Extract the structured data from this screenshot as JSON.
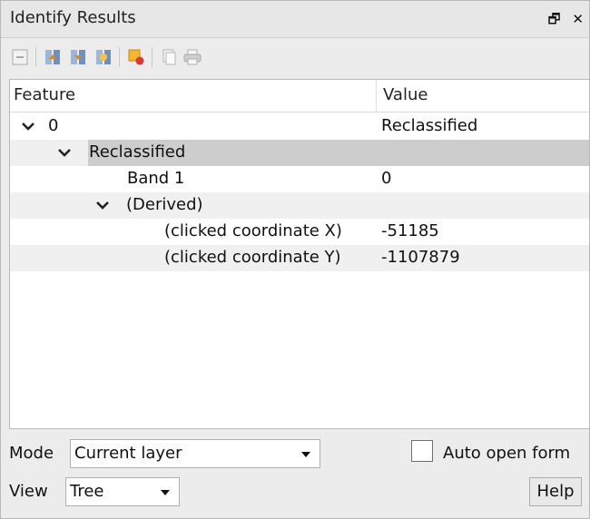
{
  "title": "Identify Results",
  "title_buttons": {
    "float": "🗗",
    "close": "✕"
  },
  "toolbar": {
    "icons": [
      "expand-new-features-icon",
      "expand-tree-icon",
      "collapse-tree-icon",
      "expand-all-icon",
      "deselect-features-icon",
      "copy-icon",
      "print-icon"
    ]
  },
  "tree": {
    "columns": [
      "Feature",
      "Value"
    ],
    "rows": [
      {
        "label": "0",
        "value": "Reclassified"
      },
      {
        "label": "Reclassified",
        "value": ""
      },
      {
        "label": "Band 1",
        "value": "0"
      },
      {
        "label": "(Derived)",
        "value": ""
      },
      {
        "label": "(clicked coordinate X)",
        "value": "-51185"
      },
      {
        "label": "(clicked coordinate Y)",
        "value": "-1107879"
      }
    ]
  },
  "mode": {
    "label": "Mode",
    "selected": "Current layer"
  },
  "auto_open_form": {
    "label": "Auto open form",
    "checked": false
  },
  "view": {
    "label": "View",
    "selected": "Tree"
  },
  "help_label": "Help",
  "colors": {
    "highlight_row": "#cdcdcd",
    "accent_icon": "#f5a623"
  }
}
